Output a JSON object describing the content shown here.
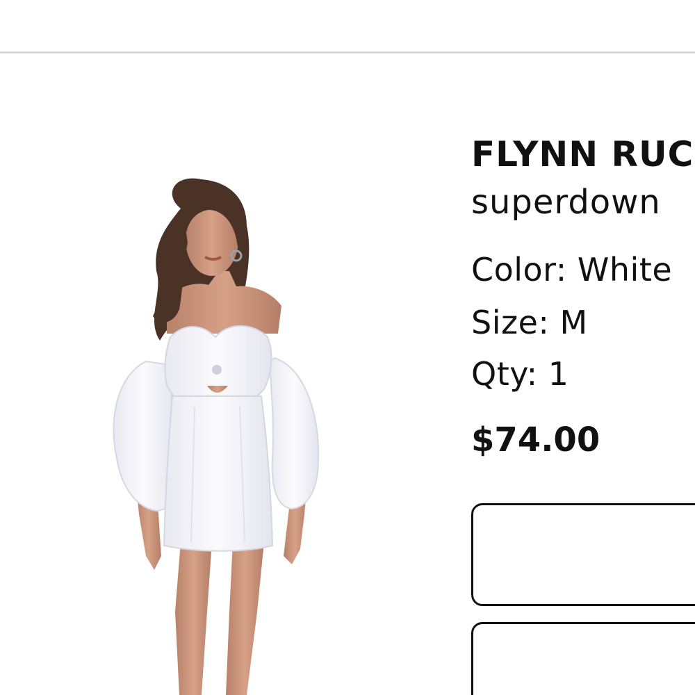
{
  "product": {
    "name": "FLYNN RUC",
    "brand": "superdown",
    "color_label": "Color: White",
    "size_label": "Size: M",
    "qty_label": "Qty: 1",
    "price": "$74.00"
  },
  "colors": {
    "text": "#111111",
    "divider": "#d9d9d9",
    "background": "#ffffff",
    "dress": "#f7f7fb",
    "skin": "#c9937a",
    "hair": "#4a3326"
  }
}
